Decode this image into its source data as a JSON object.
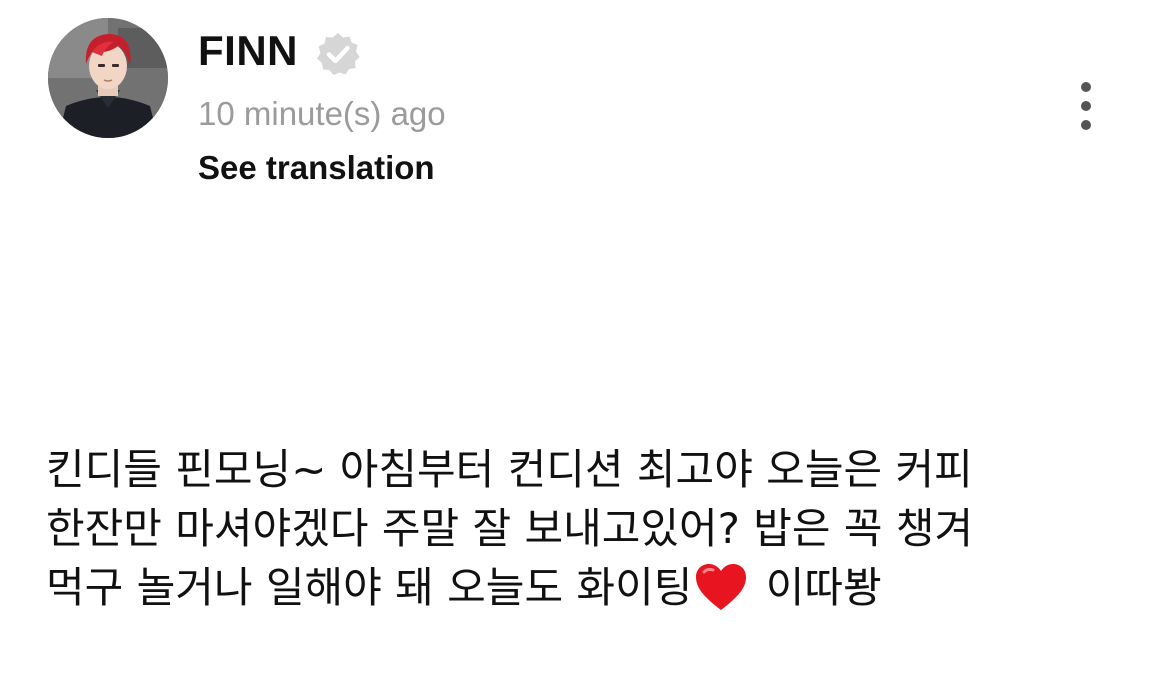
{
  "post": {
    "author": {
      "name": "FINN",
      "verified": true,
      "avatar_icon": "avatar-red-hair-illustration"
    },
    "timestamp": "10 minute(s) ago",
    "see_translation_label": "See translation",
    "more_icon": "more-vertical-icon",
    "body": {
      "line1": "킨디들 핀모닝~ 아침부터 컨디션 최고야 오늘은 커피",
      "line2": "한잔만 마셔야겠다 주말 잘 보내고있어? 밥은 꼭 챙겨",
      "line3_before_heart": "먹구 놀거나 일해야 돼 오늘도 화이팅",
      "heart_icon": "red-heart-emoji",
      "line3_after_heart": " 이따봥"
    }
  },
  "colors": {
    "text": "#111111",
    "timestamp": "#9b9b9b",
    "verified_badge": "#d6d6d6",
    "heart": "#e8141f",
    "menu_dots": "#555555"
  }
}
